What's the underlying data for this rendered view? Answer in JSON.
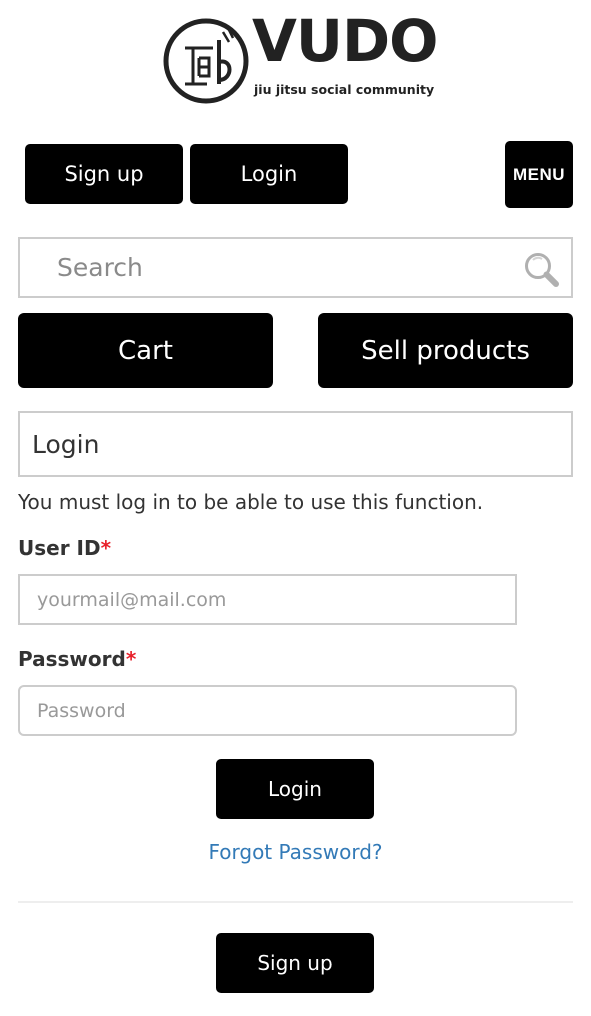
{
  "logo": {
    "wordmark": "VUDO",
    "tagline": "jiu jitsu social community"
  },
  "nav": {
    "signup_label": "Sign up",
    "login_label": "Login",
    "menu_label": "MENU"
  },
  "search": {
    "placeholder": "Search",
    "icon": "search-icon"
  },
  "shop": {
    "cart_label": "Cart",
    "sell_label": "Sell products"
  },
  "login_form": {
    "heading": "Login",
    "notice": "You must log in to be able to use this function.",
    "user_id_label": "User ID",
    "user_id_placeholder": "yourmail@mail.com",
    "password_label": "Password",
    "password_placeholder": "Password",
    "required_marker": "*",
    "submit_label": "Login",
    "forgot_label": "Forgot Password?",
    "signup_label": "Sign up"
  },
  "colors": {
    "button_bg": "#000000",
    "button_text": "#ffffff",
    "required": "#e8202a",
    "link": "#337ab7",
    "border": "#cccccc"
  }
}
